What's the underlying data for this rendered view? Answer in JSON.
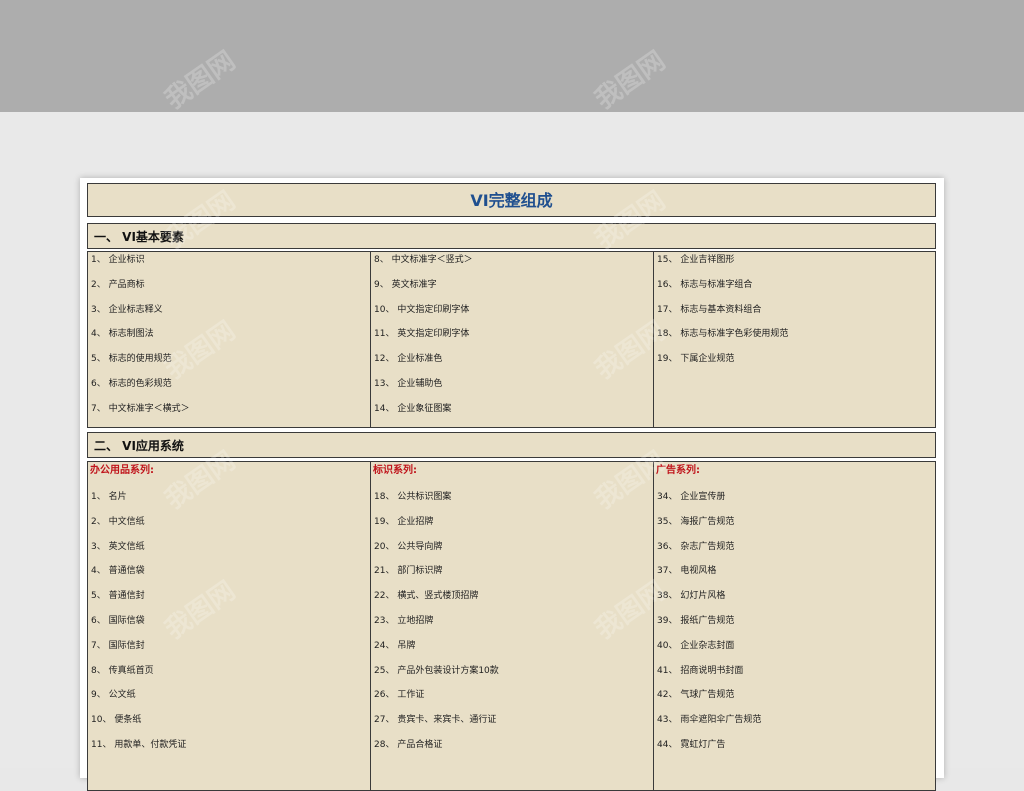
{
  "watermark": "我图网",
  "title": "VI完整组成",
  "section1": {
    "heading": "一、 VI基本要素",
    "col1": [
      "1、 企业标识",
      "2、 产品商标",
      "3、 企业标志释义",
      "4、 标志制图法",
      "5、 标志的使用规范",
      "6、 标志的色彩规范",
      "7、 中文标准字＜横式＞"
    ],
    "col2": [
      "8、 中文标准字＜竖式＞",
      "9、 英文标准字",
      "10、 中文指定印刷字体",
      "11、 英文指定印刷字体",
      "12、 企业标准色",
      "13、 企业辅助色",
      "14、 企业象征图案"
    ],
    "col3": [
      "15、 企业吉祥图形",
      "16、 标志与标准字组合",
      "17、 标志与基本资料组合",
      "18、 标志与标准字色彩使用规范",
      "19、 下属企业规范"
    ]
  },
  "section2": {
    "heading": "二、 VI应用系统",
    "col1": {
      "category": "办公用品系列:",
      "items": [
        "1、 名片",
        "2、 中文信纸",
        "3、 英文信纸",
        "4、 普通信袋",
        "5、 普通信封",
        "6、 国际信袋",
        "7、 国际信封",
        "8、 传真纸首页",
        "9、 公文纸",
        "10、 便条纸",
        "11、 用款单、付款凭证"
      ]
    },
    "col2": {
      "category": "标识系列:",
      "items": [
        "18、 公共标识图案",
        "19、 企业招牌",
        "20、 公共导向牌",
        "21、 部门标识牌",
        "22、 横式、竖式楼顶招牌",
        "23、 立地招牌",
        "24、 吊牌",
        "25、 产品外包装设计方案10款",
        "26、 工作证",
        "27、 贵宾卡、来宾卡、通行证",
        "28、 产品合格证"
      ]
    },
    "col3": {
      "category": "广告系列:",
      "items": [
        "34、 企业宣传册",
        "35、 海报广告规范",
        "36、 杂志广告规范",
        "37、 电视风格",
        "38、 幻灯片风格",
        "39、 报纸广告规范",
        "40、 企业杂志封面",
        "41、 招商说明书封面",
        "42、 气球广告规范",
        "43、 雨伞遮阳伞广告规范",
        "44、 霓虹灯广告"
      ]
    }
  }
}
